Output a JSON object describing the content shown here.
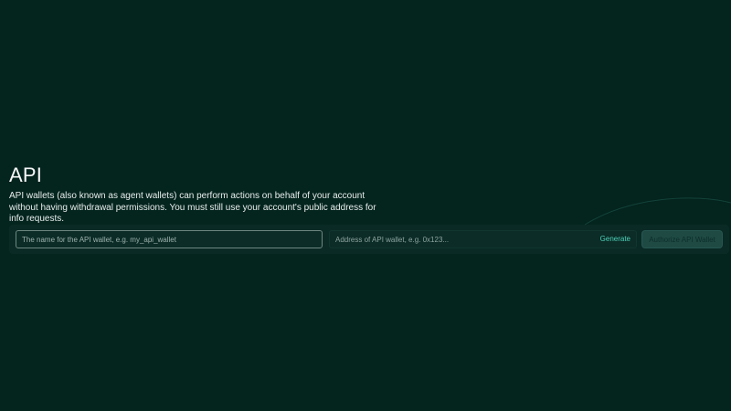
{
  "page": {
    "title": "API",
    "description": "API wallets (also known as agent wallets) can perform actions on behalf of your account without having withdrawal permissions. You must still use your account's public address for info requests."
  },
  "form": {
    "name_input": {
      "value": "",
      "placeholder": "The name for the API wallet, e.g. my_api_wallet"
    },
    "address_input": {
      "value": "",
      "placeholder": "Address of API wallet, e.g. 0x123..."
    },
    "generate_label": "Generate",
    "authorize_label": "Authorize API Wallet"
  },
  "colors": {
    "background": "#04241e",
    "panel": "#0a2a25",
    "accent": "#4fd1b8",
    "button_disabled": "#1f4a44"
  }
}
